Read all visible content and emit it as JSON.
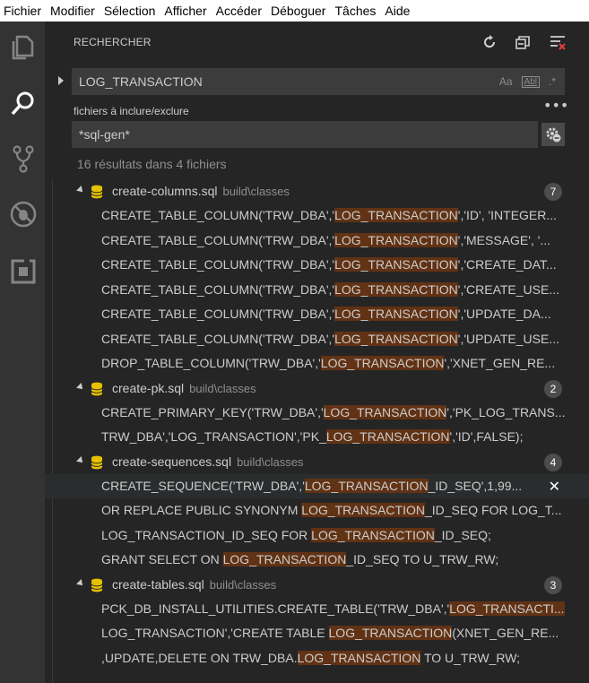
{
  "menu": [
    "Fichier",
    "Modifier",
    "Sélection",
    "Afficher",
    "Accéder",
    "Déboguer",
    "Tâches",
    "Aide"
  ],
  "activity_icons": [
    "explorer-icon",
    "search-icon",
    "source-control-icon",
    "debug-icon",
    "extensions-icon"
  ],
  "panel": {
    "title": "RECHERCHER",
    "actions": [
      "refresh-icon",
      "collapse-all-icon",
      "clear-results-icon"
    ]
  },
  "search": {
    "value": "LOG_TRANSACTION",
    "opt_case": "Aa",
    "opt_word": "Abl",
    "opt_regex": ".*"
  },
  "include": {
    "label": "fichiers à inclure/exclure",
    "more": "•••",
    "value": "*sql-gen*"
  },
  "summary": "16 résultats dans 4 fichiers",
  "files": [
    {
      "name": "create-columns.sql",
      "dir": "build\\classes",
      "count": "7",
      "matches": [
        {
          "pre": "CREATE_TABLE_COLUMN('TRW_DBA','",
          "hit": "LOG_TRANSACTION",
          "post": "','ID', 'INTEGER..."
        },
        {
          "pre": "CREATE_TABLE_COLUMN('TRW_DBA','",
          "hit": "LOG_TRANSACTION",
          "post": "','MESSAGE', '..."
        },
        {
          "pre": "CREATE_TABLE_COLUMN('TRW_DBA','",
          "hit": "LOG_TRANSACTION",
          "post": "','CREATE_DAT..."
        },
        {
          "pre": "CREATE_TABLE_COLUMN('TRW_DBA','",
          "hit": "LOG_TRANSACTION",
          "post": "','CREATE_USE..."
        },
        {
          "pre": "CREATE_TABLE_COLUMN('TRW_DBA','",
          "hit": "LOG_TRANSACTION",
          "post": "','UPDATE_DA..."
        },
        {
          "pre": "CREATE_TABLE_COLUMN('TRW_DBA','",
          "hit": "LOG_TRANSACTION",
          "post": "','UPDATE_USE..."
        },
        {
          "pre": "DROP_TABLE_COLUMN('TRW_DBA','",
          "hit": "LOG_TRANSACTION",
          "post": "','XNET_GEN_RE..."
        }
      ]
    },
    {
      "name": "create-pk.sql",
      "dir": "build\\classes",
      "count": "2",
      "matches": [
        {
          "pre": "CREATE_PRIMARY_KEY('TRW_DBA','",
          "hit": "LOG_TRANSACTION",
          "post": "','PK_LOG_TRANS..."
        },
        {
          "pre": "TRW_DBA','LOG_TRANSACTION','PK_",
          "hit": "LOG_TRANSACTION",
          "post": "','ID',FALSE);"
        }
      ]
    },
    {
      "name": "create-sequences.sql",
      "dir": "build\\classes",
      "count": "4",
      "matches": [
        {
          "pre": "CREATE_SEQUENCE('TRW_DBA','",
          "hit": "LOG_TRANSACTION",
          "post": "_ID_SEQ',1,99...",
          "selected": true
        },
        {
          "pre": "OR REPLACE PUBLIC SYNONYM ",
          "hit": "LOG_TRANSACTION",
          "post": "_ID_SEQ FOR LOG_T..."
        },
        {
          "pre": "LOG_TRANSACTION_ID_SEQ FOR ",
          "hit": "LOG_TRANSACTION",
          "post": "_ID_SEQ;"
        },
        {
          "pre": "GRANT SELECT ON ",
          "hit": "LOG_TRANSACTION",
          "post": "_ID_SEQ TO U_TRW_RW;"
        }
      ]
    },
    {
      "name": "create-tables.sql",
      "dir": "build\\classes",
      "count": "3",
      "matches": [
        {
          "pre": "PCK_DB_INSTALL_UTILITIES.CREATE_TABLE('TRW_DBA','",
          "hit": "LOG_TRANSACTI...",
          "post": ""
        },
        {
          "pre": "LOG_TRANSACTION','CREATE TABLE ",
          "hit": "LOG_TRANSACTION",
          "post": "(XNET_GEN_RE..."
        },
        {
          "pre": ",UPDATE,DELETE ON TRW_DBA.",
          "hit": "LOG_TRANSACTION",
          "post": " TO U_TRW_RW;"
        }
      ]
    }
  ],
  "close_glyph": "✕",
  "colors": {
    "highlight": "#613214",
    "sidebar": "#252526",
    "activitybar": "#333333",
    "input": "#3c3c3c"
  }
}
